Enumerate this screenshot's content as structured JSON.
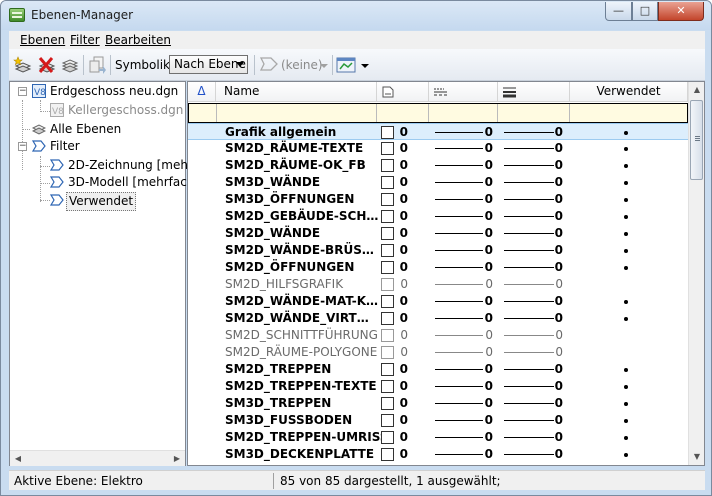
{
  "window": {
    "title": "Ebenen-Manager",
    "controls": {
      "minimize": "—",
      "maximize": "□",
      "close": "✕"
    }
  },
  "menu": {
    "items": [
      {
        "label": "Ebenen",
        "mnemonic": "E"
      },
      {
        "label": "Filter",
        "mnemonic": "F"
      },
      {
        "label": "Bearbeiten",
        "mnemonic": "B"
      }
    ]
  },
  "toolbar": {
    "new_level_icon": "new-level-icon",
    "delete_level_icon": "delete-level-icon",
    "copy_level_icon": "copy-level-icon",
    "symbology_label": "Symbolik:",
    "symbology_value": "Nach Ebene",
    "filter_value": "(keine)",
    "display_icon": "level-display-icon"
  },
  "tree": {
    "items": [
      {
        "label": "Erdgeschoss neu.dgn",
        "icon": "dgn-file-icon",
        "level": 0,
        "expanded": true
      },
      {
        "label": "Kellergeschoss.dgn",
        "icon": "dgn-reference-icon",
        "level": 1,
        "dimmed": true
      },
      {
        "label": "Alle Ebenen",
        "icon": "levels-stack-icon",
        "level": 0
      },
      {
        "label": "Filter",
        "icon": "filter-icon",
        "level": 0,
        "expanded": true
      },
      {
        "label": "2D-Zeichnung [meh…",
        "icon": "filter-icon",
        "level": 1
      },
      {
        "label": "3D-Modell [mehrfac…",
        "icon": "filter-icon",
        "level": 1
      },
      {
        "label": "Verwendet",
        "icon": "filter-icon",
        "level": 1,
        "selected": true
      }
    ]
  },
  "columns": {
    "sort_indicator": "Δ",
    "name": "Name",
    "color_icon": "color-column-icon",
    "style_icon": "line-style-column-icon",
    "weight_icon": "line-weight-column-icon",
    "used": "Verwendet"
  },
  "levels": [
    {
      "name": "Grafik allgemein",
      "color": "0",
      "style": "0",
      "weight": "0",
      "used": true,
      "bold": true,
      "selected": true
    },
    {
      "name": "SM2D_RÄUME-TEXTE",
      "color": "0",
      "style": "0",
      "weight": "0",
      "used": true,
      "bold": true
    },
    {
      "name": "SM2D_RÄUME-OK_FB",
      "color": "0",
      "style": "0",
      "weight": "0",
      "used": true,
      "bold": true
    },
    {
      "name": "SM3D_WÄNDE",
      "color": "0",
      "style": "0",
      "weight": "0",
      "used": true,
      "bold": true
    },
    {
      "name": "SM3D_ÖFFNUNGEN",
      "color": "0",
      "style": "0",
      "weight": "0",
      "used": true,
      "bold": true
    },
    {
      "name": "SM2D_GEBÄUDE-SCH…",
      "color": "0",
      "style": "0",
      "weight": "0",
      "used": true,
      "bold": true
    },
    {
      "name": "SM2D_WÄNDE",
      "color": "0",
      "style": "0",
      "weight": "0",
      "used": true,
      "bold": true
    },
    {
      "name": "SM2D_WÄNDE-BRÜS…",
      "color": "0",
      "style": "0",
      "weight": "0",
      "used": true,
      "bold": true
    },
    {
      "name": "SM2D_ÖFFNUNGEN",
      "color": "0",
      "style": "0",
      "weight": "0",
      "used": true,
      "bold": true
    },
    {
      "name": "SM2D_HILFSGRAFIK",
      "color": "0",
      "style": "0",
      "weight": "0",
      "used": false,
      "bold": false
    },
    {
      "name": "SM2D_WÄNDE-MAT-K…",
      "color": "0",
      "style": "0",
      "weight": "0",
      "used": true,
      "bold": true
    },
    {
      "name": "SM2D_WÄNDE_VIRT…",
      "color": "0",
      "style": "0",
      "weight": "0",
      "used": true,
      "bold": true
    },
    {
      "name": "SM2D_SCHNITTFÜHRUNG",
      "color": "0",
      "style": "0",
      "weight": "0",
      "used": false,
      "bold": false
    },
    {
      "name": "SM2D_RÄUME-POLYGONE",
      "color": "0",
      "style": "0",
      "weight": "0",
      "used": false,
      "bold": false
    },
    {
      "name": "SM2D_TREPPEN",
      "color": "0",
      "style": "0",
      "weight": "0",
      "used": true,
      "bold": true
    },
    {
      "name": "SM2D_TREPPEN-TEXTE",
      "color": "0",
      "style": "0",
      "weight": "0",
      "used": true,
      "bold": true
    },
    {
      "name": "SM3D_TREPPEN",
      "color": "0",
      "style": "0",
      "weight": "0",
      "used": true,
      "bold": true
    },
    {
      "name": "SM3D_FUSSBODEN",
      "color": "0",
      "style": "0",
      "weight": "0",
      "used": true,
      "bold": true
    },
    {
      "name": "SM2D_TREPPEN-UMRISS",
      "color": "0",
      "style": "0",
      "weight": "0",
      "used": true,
      "bold": true
    },
    {
      "name": "SM3D_DECKENPLATTE",
      "color": "0",
      "style": "0",
      "weight": "0",
      "used": true,
      "bold": true
    }
  ],
  "status": {
    "active_level": "Aktive Ebene: Elektro",
    "count": "85 von 85 dargestellt, 1 ausgewählt;"
  },
  "colors": {
    "selection": "#dceefc",
    "filter_row": "#fffbe1",
    "title_bar": "#c5d9ef"
  }
}
